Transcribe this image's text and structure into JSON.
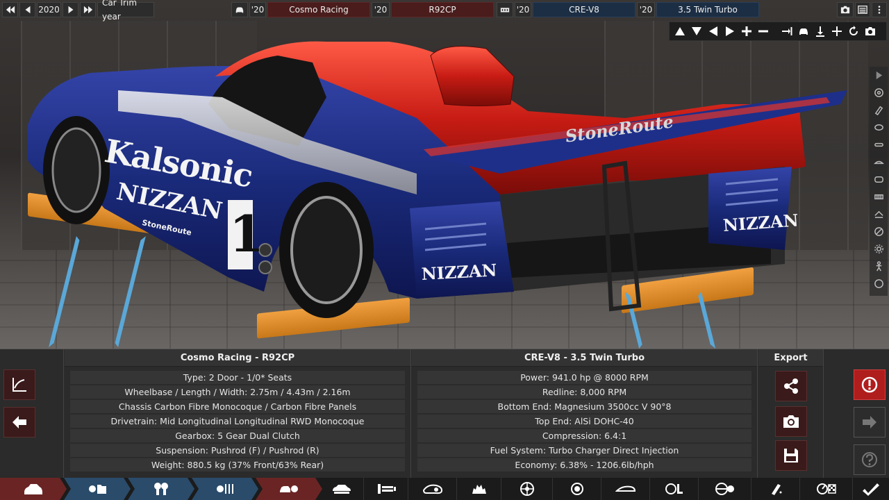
{
  "topbar": {
    "year": "2020",
    "trim_year_label": "Car Trim year",
    "model_year": "'20",
    "model_family": "Cosmo Racing",
    "trim_year": "'20",
    "trim_name": "R92CP",
    "engine_year": "'20",
    "engine_family": "CRE-V8",
    "variant_year": "'20",
    "variant_name": "3.5 Twin Turbo"
  },
  "car_panel": {
    "title": "Cosmo Racing - R92CP",
    "rows": [
      "Type: 2 Door - 1/0* Seats",
      "Wheelbase / Length / Width: 2.75m / 4.43m / 2.16m",
      "Chassis Carbon Fibre Monocoque / Carbon Fibre Panels",
      "Drivetrain: Mid Longitudinal Longitudinal RWD Monocoque",
      "Gearbox: 5 Gear Dual Clutch",
      "Suspension: Pushrod (F) / Pushrod (R)",
      "Weight: 880.5 kg (37% Front/63% Rear)"
    ]
  },
  "engine_panel": {
    "title": "CRE-V8 - 3.5 Twin Turbo",
    "rows": [
      "Power: 941.0 hp @ 8000 RPM",
      "Redline:  8,000 RPM",
      "Bottom End: Magnesium 3500cc V 90°8",
      "Top End: AlSi DOHC-40",
      "Compression: 6.4:1",
      "Fuel System: Turbo Charger Direct Injection",
      "Economy: 6.38% - 1206.6lb/hph"
    ]
  },
  "export": {
    "title": "Export"
  },
  "livery": {
    "side_sponsor": "Kalsonic",
    "side_brand": "NIZZAN",
    "small_sponsor": "StoneRoute",
    "race_number": "1",
    "wing_sponsor": "StoneRoute",
    "rear_brand": "NIZZAN",
    "rear_brand_2": "NIZZAN"
  },
  "colors": {
    "red_tab": "#6a2424",
    "blue_tab": "#2a4b6a",
    "alert": "#b01d1d",
    "car_red": "#c81c14",
    "car_blue": "#1a2a7a"
  }
}
